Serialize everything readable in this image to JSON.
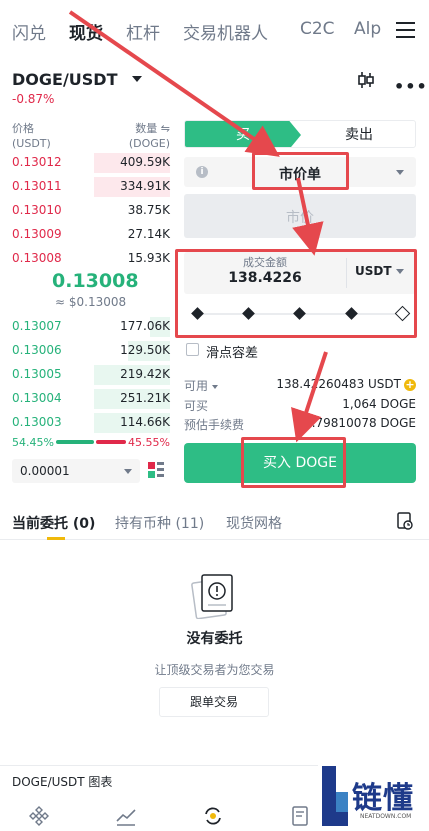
{
  "top_tabs": [
    "闪兑",
    "现货",
    "杠杆",
    "交易机器人",
    "C2C",
    "Alp"
  ],
  "pair": {
    "name": "DOGE/USDT",
    "change": "-0.87%"
  },
  "orderbook": {
    "price_header": "价格",
    "price_unit": "(USDT)",
    "qty_header": "数量 ⇋",
    "qty_unit": "(DOGE)",
    "asks": [
      {
        "price": "0.13012",
        "qty": "409.59K",
        "depth": 0.45
      },
      {
        "price": "0.13011",
        "qty": "334.91K",
        "depth": 0.45
      },
      {
        "price": "0.13010",
        "qty": "38.75K",
        "depth": 0.0
      },
      {
        "price": "0.13009",
        "qty": "27.14K",
        "depth": 0.0
      },
      {
        "price": "0.13008",
        "qty": "15.93K",
        "depth": 0.0
      }
    ],
    "last_price": "0.13008",
    "last_price_usd": "≈ $0.13008",
    "bids": [
      {
        "price": "0.13007",
        "qty": "177.06K",
        "depth": 0.12
      },
      {
        "price": "0.13006",
        "qty": "129.50K",
        "depth": 0.25
      },
      {
        "price": "0.13005",
        "qty": "219.42K",
        "depth": 0.45
      },
      {
        "price": "0.13004",
        "qty": "251.21K",
        "depth": 0.45
      },
      {
        "price": "0.13003",
        "qty": "114.66K",
        "depth": 0.45
      }
    ],
    "buy_ratio": "54.45%",
    "sell_ratio": "45.55%",
    "depth_value": "0.00001"
  },
  "form": {
    "buy_tab": "买",
    "sell_tab": "卖出",
    "order_type": "市价单",
    "price_placeholder": "市价",
    "amount_label": "成交金额",
    "amount_value": "138.4226",
    "amount_unit": "USDT",
    "slider_fraction": 1.0,
    "slippage_label": "滑点容差",
    "available_label": "可用",
    "available_value": "138.42260483 USDT",
    "can_buy_label": "可买",
    "can_buy_value": "1,064 DOGE",
    "fee_label": "预估手续费",
    "fee_value": "0.79810078 DOGE",
    "buy_button": "买入 DOGE"
  },
  "orders": {
    "tabs": [
      "当前委托 (0)",
      "持有币种 (11)",
      "现货网格"
    ],
    "empty_title": "没有委托",
    "empty_sub": "让顶级交易者为您交易",
    "copy_button": "跟单交易"
  },
  "chart_bar_label": "DOGE/USDT 图表",
  "watermark": {
    "text": "链懂",
    "sub": "NEATDOWN.COM"
  },
  "colors": {
    "green": "#2ebd85",
    "red": "#e0294a",
    "annotation": "#e5484d",
    "accent": "#f0b90b"
  }
}
